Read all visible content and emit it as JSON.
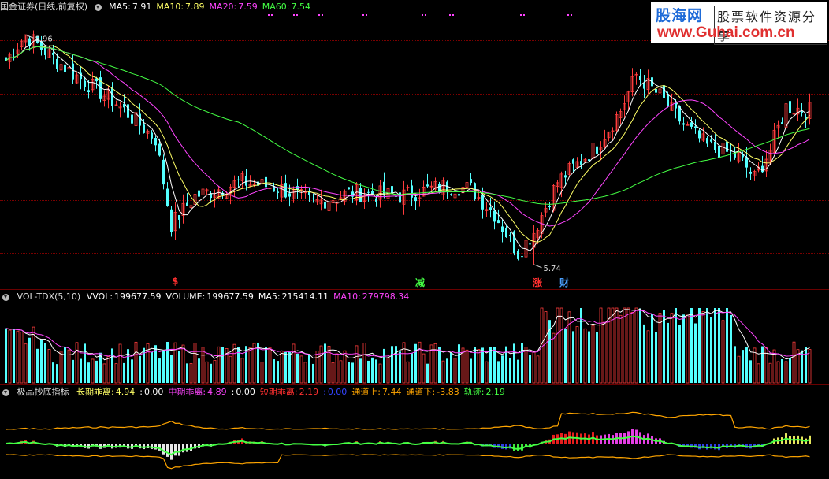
{
  "main": {
    "title": "国金证券(日线,前复权)",
    "legend": [
      {
        "label": "MA5:",
        "value": "7.91",
        "color": "#ffffff"
      },
      {
        "label": "MA10:",
        "value": "7.89",
        "color": "#ffff66"
      },
      {
        "label": "MA20:",
        "value": "7.59",
        "color": "#ff44ff"
      },
      {
        "label": "MA60:",
        "value": "7.54",
        "color": "#44ff44"
      }
    ],
    "high_label": "8.96",
    "low_label": "5.74",
    "markers": [
      {
        "text": "$",
        "color": "#ff3030"
      },
      {
        "text": "减",
        "color": "#44ff44"
      },
      {
        "text": "涨",
        "color": "#ff3030"
      },
      {
        "text": "财",
        "color": "#4aa0ff"
      }
    ]
  },
  "logo": {
    "line1": "股海网",
    "line2": "股票软件资源分享",
    "line3": "www.Guhai.com.cn"
  },
  "volume": {
    "title": "VOL-TDX(5,10)",
    "items": [
      {
        "label": "VVOL:",
        "value": "199677.59",
        "color": "#ffffff"
      },
      {
        "label": "VOLUME:",
        "value": "199677.59",
        "color": "#ffffff"
      },
      {
        "label": "MA5:",
        "value": "215414.11",
        "color": "#ffffff"
      },
      {
        "label": "MA10:",
        "value": "279798.34",
        "color": "#ff44ff"
      }
    ]
  },
  "indicator": {
    "title": "极品抄底指标",
    "items": [
      {
        "label": "长期乖离:",
        "value": "4.94",
        "color": "#ffff66"
      },
      {
        "label": ":",
        "value": "0.00",
        "color": "#ffffff"
      },
      {
        "label": "中期乖离:",
        "value": "4.89",
        "color": "#ff44ff"
      },
      {
        "label": ":",
        "value": "0.00",
        "color": "#ffffff"
      },
      {
        "label": "短期乖离:",
        "value": "2.19",
        "color": "#ff3030"
      },
      {
        "label": ":",
        "value": "0.00",
        "color": "#3344ff"
      },
      {
        "label": "通道上:",
        "value": "7.44",
        "color": "#ffa500"
      },
      {
        "label": "通道下:",
        "value": "-3.83",
        "color": "#ffa500"
      },
      {
        "label": "轨迹:",
        "value": "2.19",
        "color": "#44ff44"
      }
    ]
  },
  "colors": {
    "up": "#ff3c3c",
    "down": "#54ffff",
    "ma5": "#ffffff",
    "ma10": "#ffff66",
    "ma20": "#ff44ff",
    "ma60": "#44ff44",
    "bg": "#000000"
  }
}
